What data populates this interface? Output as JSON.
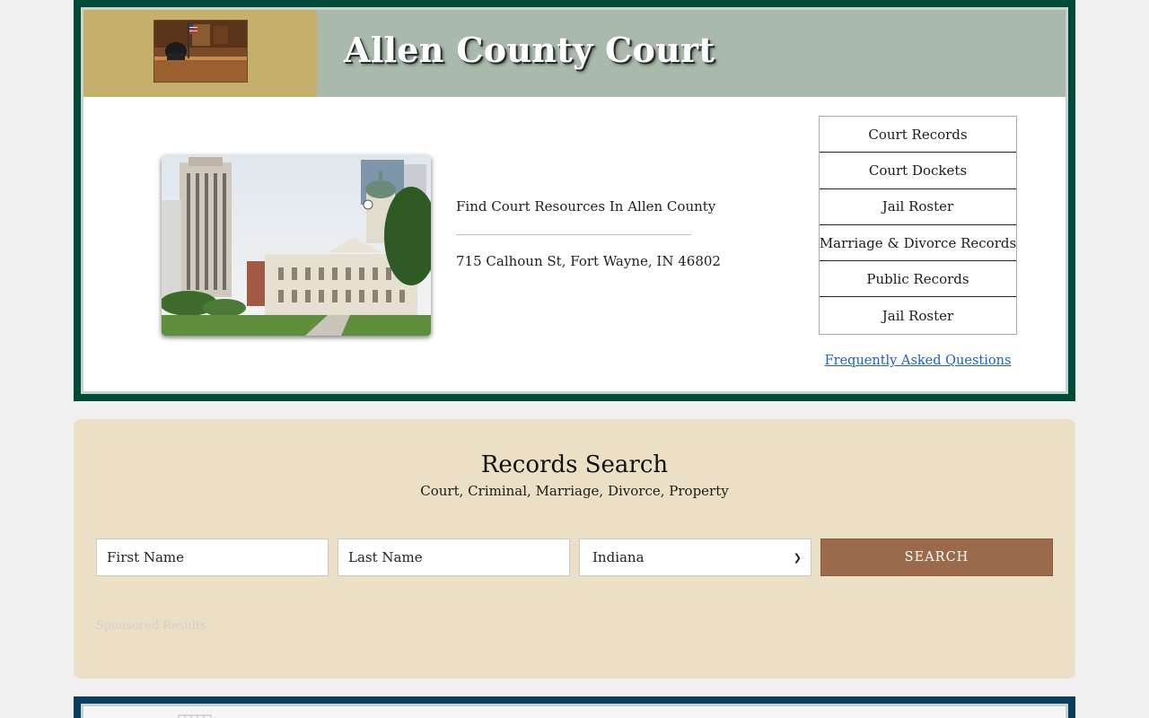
{
  "header": {
    "title": "Allen County Court",
    "gavel_photo_icon": "courtroom-photo",
    "building_photo_icon": "courthouse-photo"
  },
  "info": {
    "tagline": "Find Court Resources In Allen County",
    "address": "715 Calhoun St, Fort Wayne, IN 46802"
  },
  "menu": {
    "items": [
      {
        "label": "Court Records"
      },
      {
        "label": "Court Dockets"
      },
      {
        "label": "Jail Roster"
      },
      {
        "label": "Marriage & Divorce Records"
      },
      {
        "label": "Public Records"
      },
      {
        "label": "Jail Roster"
      }
    ],
    "faq_label": "Frequently Asked Questions"
  },
  "search": {
    "title": "Records Search",
    "subtitle": "Court, Criminal, Marriage, Divorce, Property",
    "first_name_placeholder": "First Name",
    "last_name_placeholder": "Last Name",
    "state_value": "Indiana",
    "button_label": "SEARCH",
    "sponsored_label": "Sponsored Results"
  },
  "colors": {
    "page_bg": "#f0f0f0",
    "court_frame": "#004a3a",
    "banner_gold": "#c4b06a",
    "banner_sage": "#a9b9ab",
    "search_bg": "#ebe0c5",
    "search_button": "#9b6a4b",
    "link": "#1a5fc4",
    "bottom_frame": "#0a3e5c"
  }
}
